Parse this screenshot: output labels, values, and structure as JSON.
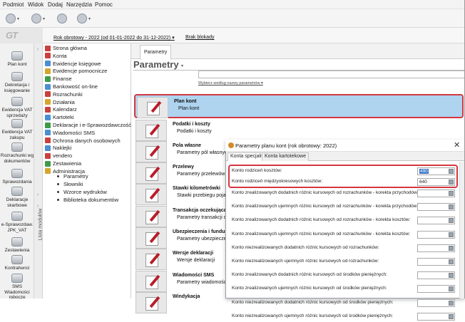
{
  "menu": [
    "Podmiot",
    "Widok",
    "Dodaj",
    "Narzędzia",
    "Pomoc"
  ],
  "logo_text": "GT",
  "infobar": {
    "year_link": "Rok obrotowy - 2022  (od 01-01-2022 do 31-12-2022)",
    "year_arrow": "▾",
    "lock_link": "Brak blokady"
  },
  "modules": [
    "Plan kont",
    "Dekretacja i księgowanie",
    "Ewidencja VAT sprzedaży",
    "Ewidencja VAT zakupu",
    "Rozrachunki wg dokumentów",
    "Sprawozdania",
    "Deklaracje skarbowe",
    "e-Sprawozdaw. JPK_VAT",
    "Zestawienia",
    "Kontrahenci",
    "SMS Wiadomości robocze"
  ],
  "modules_strip_label": "Lista modułów",
  "tree": [
    {
      "label": "Strona główna",
      "color": "#c9413d"
    },
    {
      "label": "Konta",
      "color": "#c9413d"
    },
    {
      "label": "Ewidencje księgowe",
      "color": "#4a8fd1"
    },
    {
      "label": "Ewidencje pomocnicze",
      "color": "#d6a52e"
    },
    {
      "label": "Finanse",
      "color": "#3f9b4a"
    },
    {
      "label": "Bankowość on-line",
      "color": "#4a8fd1"
    },
    {
      "label": "Rozrachunki",
      "color": "#c9413d"
    },
    {
      "label": "Działania",
      "color": "#d6a52e"
    },
    {
      "label": "Kalendarz",
      "color": "#c9413d"
    },
    {
      "label": "Kartoteki",
      "color": "#4a8fd1"
    },
    {
      "label": "Deklaracje i e-Sprawozdawczość",
      "color": "#3f9b4a"
    },
    {
      "label": "Wiadomości SMS",
      "color": "#4a8fd1"
    },
    {
      "label": "Ochrona danych osobowych",
      "color": "#c9413d"
    },
    {
      "label": "Naklejki",
      "color": "#4a8fd1"
    },
    {
      "label": "vendero",
      "color": "#c9413d"
    },
    {
      "label": "Zestawienia",
      "color": "#3f9b4a"
    },
    {
      "label": "Administracja",
      "color": "#d6a52e"
    }
  ],
  "tree_sub": [
    "Parametry",
    "Słowniki",
    "Wzorce wydruków",
    "Biblioteka dokumentów"
  ],
  "tab_label": "Parametry",
  "page_title": "Parametry",
  "title_arrow": "▾",
  "search_hint": "Wybierz według nazwy parametrów ▾",
  "params": [
    {
      "name": "Plan kont",
      "desc": "Plan kont"
    },
    {
      "name": "Podatki i koszty",
      "desc": "Podatki i koszty"
    },
    {
      "name": "Pola własne",
      "desc": "Parametry pól własnych"
    },
    {
      "name": "Przelewy",
      "desc": "Parametry przelewów"
    },
    {
      "name": "Stawki kilometrówki",
      "desc": "Stawki przebiegu pojazdów"
    },
    {
      "name": "Transakcja oczekująca",
      "desc": "Parametry transakcji oczekującej"
    },
    {
      "name": "Ubezpieczenia i fundusze",
      "desc": "Parametry ubezpieczeń"
    },
    {
      "name": "Wersje deklaracji",
      "desc": "Wersje deklaracji"
    },
    {
      "name": "Wiadomości SMS",
      "desc": "Parametry wiadomości SMS"
    },
    {
      "name": "Windykacja",
      "desc": ""
    }
  ],
  "dialog": {
    "title": "Parametry planu kont (rok obrotowy: 2022)",
    "close": "✕",
    "tabs": [
      "Konta specjalne",
      "Konta kartotekowe"
    ],
    "rows": [
      {
        "label": "Konto rodziceń kosztów:",
        "value": "490"
      },
      {
        "label": "Konto rodziceń międzyokresowych kosztów:",
        "value": "640"
      },
      {
        "label": "Konto zrealizowanych dodatnich różnic kursowych od rozrachunków - korekta przychodów:",
        "value": ""
      },
      {
        "label": "Konto zrealizowanych ujemnych różnic kursowych od rozrachunków - korekta przychodów:",
        "value": ""
      },
      {
        "label": "Konto zrealizowanych dodatnich różnic kursowych od rozrachunków - korekta kosztów:",
        "value": ""
      },
      {
        "label": "Konto zrealizowanych ujemnych różnic kursowych od rozrachunków - korekta kosztów:",
        "value": ""
      },
      {
        "label": "Konto niezrealizowanych dodatnich różnic kursowych od rozrachunków:",
        "value": ""
      },
      {
        "label": "Konto niezrealizowanych ujemnych różnic kursowych od rozrachunków:",
        "value": ""
      },
      {
        "label": "Konto zrealizowanych dodatnich różnic kursowych od środków pieniężnych:",
        "value": ""
      },
      {
        "label": "Konto zrealizowanych ujemnych różnic kursowych od środków pieniężnych:",
        "value": ""
      },
      {
        "label": "Konto niezrealizowanych dodatnich różnic kursowych od środków pieniężnych:",
        "value": ""
      },
      {
        "label": "Konto niezrealizowanych ujemnych różnic kursowych od środków pieniężnych:",
        "value": ""
      }
    ]
  },
  "colors": {
    "highlight": "#d4373f",
    "selected_row": "#aed4f0",
    "selection": "#3b77c9"
  }
}
